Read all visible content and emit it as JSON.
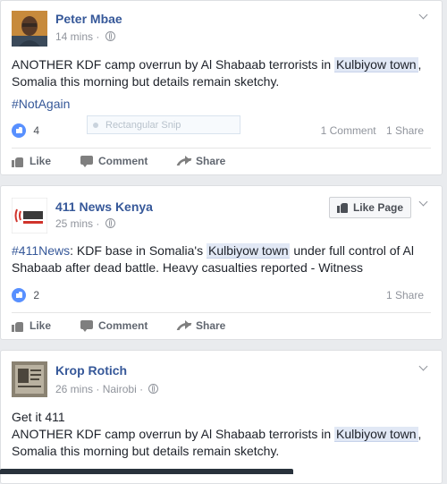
{
  "posts": [
    {
      "author": "Peter Mbae",
      "time": "14 mins",
      "sep": "·",
      "text_before": "ANOTHER KDF camp overrun by Al Shabaab terrorists in ",
      "highlight": "Kulbiyow town",
      "text_after": ", Somalia this morning but details remain sketchy.",
      "hashtag": "#NotAgain",
      "like_count": "4",
      "comments": "1 Comment",
      "shares": "1 Share",
      "actions": {
        "like": "Like",
        "comment": "Comment",
        "share": "Share"
      }
    },
    {
      "author": "411 News Kenya",
      "time": "25 mins",
      "sep": "·",
      "like_page_label": "Like Page",
      "hashtag": "#411News",
      "text_before": ": KDF base in Somalia's ",
      "highlight": "Kulbiyow town",
      "text_after": " under full control of Al Shabaab after dead battle. Heavy casualties reported - Witness",
      "like_count": "2",
      "shares": "1 Share",
      "actions": {
        "like": "Like",
        "comment": "Comment",
        "share": "Share"
      }
    },
    {
      "author": "Krop Rotich",
      "time": "26 mins",
      "sep": "·",
      "location": "Nairobi",
      "line1": "Get it 411",
      "text_before": "ANOTHER KDF camp overrun by Al Shabaab terrorists in ",
      "highlight": "Kulbiyow town",
      "text_after": ", Somalia this morning but details remain sketchy."
    }
  ],
  "snip_overlay": {
    "label": "Rectangular Snip"
  },
  "colors": {
    "link": "#365899",
    "meta": "#90949c",
    "like_badge": "#5890ff",
    "highlight_bg": "#e1e8f5"
  }
}
